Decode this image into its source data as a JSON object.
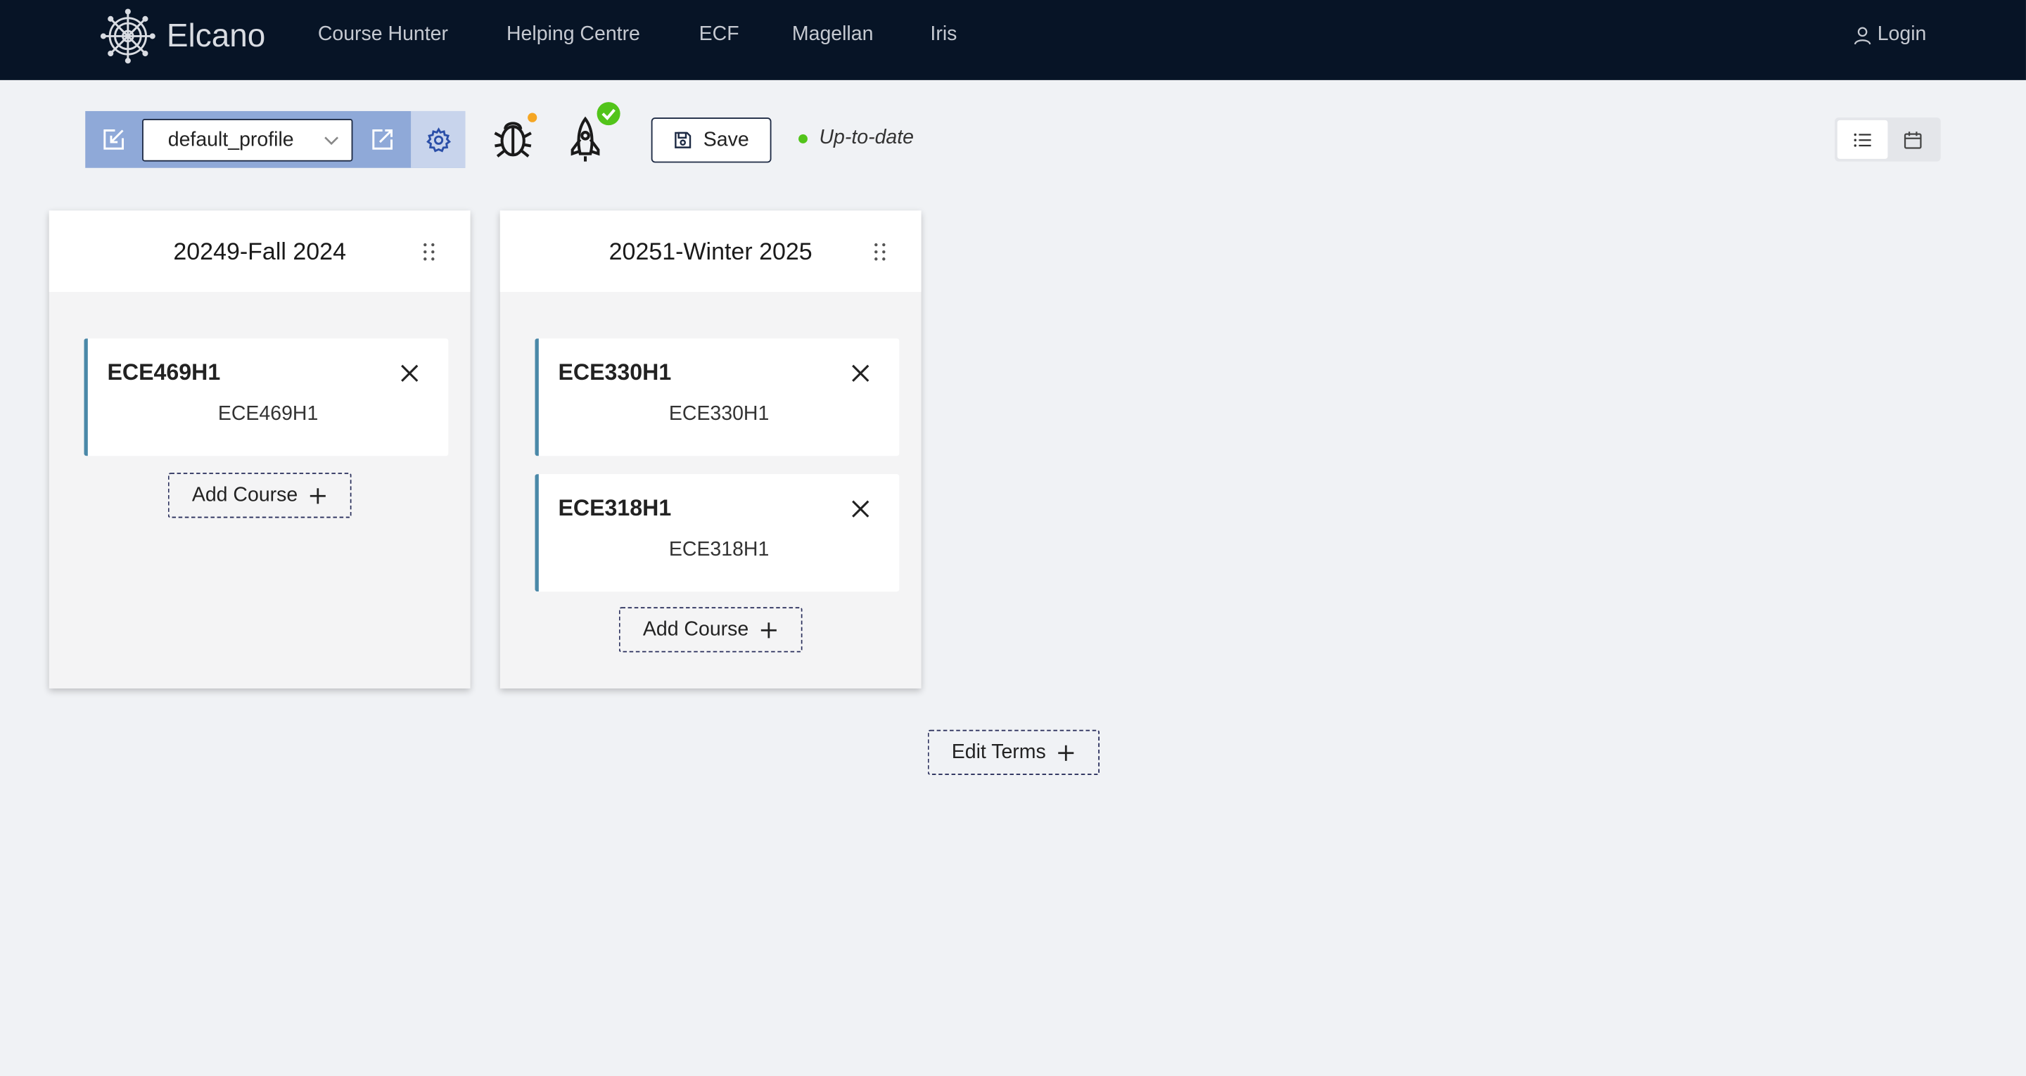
{
  "nav": {
    "brand": "Elcano",
    "links": [
      "Course Hunter",
      "Helping Centre",
      "ECF",
      "Magellan",
      "Iris"
    ],
    "login": "Login"
  },
  "toolbar": {
    "profile_value": "default_profile",
    "save_label": "Save",
    "status_text": "Up-to-date",
    "status_color": "#52c41a",
    "bug_badge_color": "#f5a623",
    "deploy_badge_color": "#52c41a",
    "icons": [
      "import-icon",
      "chevron-down-icon",
      "export-icon",
      "gear-icon",
      "bug-icon",
      "rocket-icon",
      "save-icon",
      "list-view-icon",
      "calendar-view-icon"
    ]
  },
  "terms": [
    {
      "title": "20249-Fall 2024",
      "courses": [
        {
          "code": "ECE469H1",
          "name": "ECE469H1"
        }
      ],
      "add_label": "Add Course"
    },
    {
      "title": "20251-Winter 2025",
      "courses": [
        {
          "code": "ECE330H1",
          "name": "ECE330H1"
        },
        {
          "code": "ECE318H1",
          "name": "ECE318H1"
        }
      ],
      "add_label": "Add Course"
    }
  ],
  "edit_terms_label": "Edit Terms",
  "colors": {
    "nav_bg": "#071426",
    "profile_bar": "#8fa9d8",
    "course_accent": "#4a88a8"
  }
}
